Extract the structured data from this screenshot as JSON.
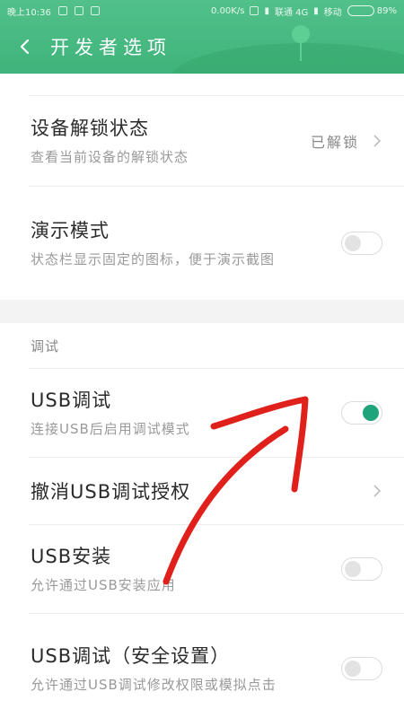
{
  "status_bar": {
    "time": "晚上10:36",
    "speed": "0.00K/s",
    "carrier_1": "联通 4G",
    "carrier_2": "移动",
    "battery_text": "89%",
    "battery_level": 0.89
  },
  "header": {
    "title": "开发者选项"
  },
  "settings": {
    "unlock_status": {
      "title": "设备解锁状态",
      "subtitle": "查看当前设备的解锁状态",
      "value": "已解锁"
    },
    "demo_mode": {
      "title": "演示模式",
      "subtitle": "状态栏显示固定的图标，便于演示截图",
      "enabled": false
    }
  },
  "debug_section": {
    "header": "调试",
    "usb_debugging": {
      "title": "USB调试",
      "subtitle": "连接USB后启用调试模式",
      "enabled": true
    },
    "revoke_auth": {
      "title": "撤消USB调试授权"
    },
    "usb_install": {
      "title": "USB安装",
      "subtitle": "允许通过USB安装应用",
      "enabled": false
    },
    "usb_debugging_security": {
      "title": "USB调试（安全设置）",
      "subtitle": "允许通过USB调试修改权限或模拟点击",
      "enabled": false
    }
  },
  "colors": {
    "header_green": "#3fb37b",
    "switch_on": "#1fa37a",
    "annotation_red": "#e0201a"
  }
}
